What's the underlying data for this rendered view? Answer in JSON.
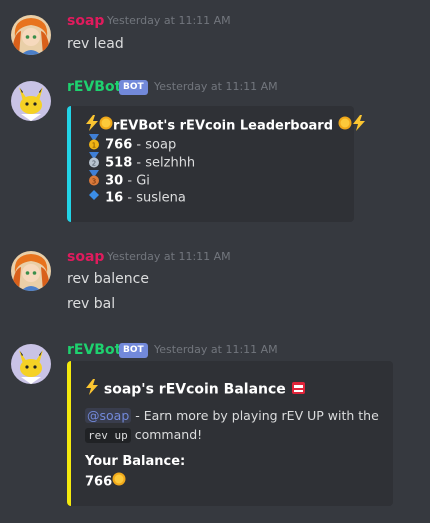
{
  "messages": [
    {
      "author": "soap",
      "author_color": "#e01b5d",
      "timestamp": "Yesterday at 11:11 AM",
      "lines": [
        "rev lead"
      ]
    },
    {
      "author": "rEVBot",
      "author_color": "#1ed26f",
      "bot_tag": "BOT",
      "timestamp": "Yesterday at 11:11 AM",
      "embed": {
        "color": "#22d3e6",
        "title": "rEVBot's rEVcoin Leaderboard",
        "rows": [
          {
            "icon": "first-place-medal-icon",
            "value": "766",
            "name": "- soap"
          },
          {
            "icon": "second-place-medal-icon",
            "value": "518",
            "name": "- selzhhh"
          },
          {
            "icon": "third-place-medal-icon",
            "value": "30",
            "name": "- Gi"
          },
          {
            "icon": "blue-diamond-icon",
            "value": "16",
            "name": "- suslena"
          }
        ]
      }
    },
    {
      "author": "soap",
      "author_color": "#e01b5d",
      "timestamp": "Yesterday at 11:11 AM",
      "lines": [
        "rev balence",
        "rev bal"
      ]
    },
    {
      "author": "rEVBot",
      "author_color": "#1ed26f",
      "bot_tag": "BOT",
      "timestamp": "Yesterday at 11:11 AM",
      "embed": {
        "color": "#f3e90d",
        "title": "soap's rEVcoin Balance",
        "mention": "@soap",
        "desc_part1": "- Earn more by playing rEV UP with the",
        "command": "rev up",
        "desc_part2": "command!",
        "field_name": "Your Balance:",
        "field_value": "766"
      }
    }
  ]
}
